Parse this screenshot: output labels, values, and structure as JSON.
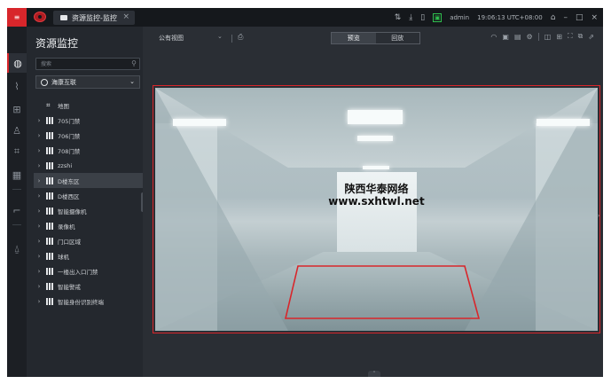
{
  "titlebar": {
    "tab_label": "资源监控-监控",
    "tab_close": "×",
    "user": "admin",
    "clock": "19:06:13 UTC+08:00",
    "window_min": "–",
    "window_max": "□",
    "window_close": "×",
    "menu_glyph": "≡"
  },
  "panel": {
    "title": "资源监控",
    "search_placeholder": "搜索",
    "site_select": "海康互联",
    "tree": [
      {
        "label": "地图",
        "kind": "map",
        "expandable": false,
        "selected": false
      },
      {
        "label": "705门禁",
        "kind": "building",
        "expandable": true,
        "selected": false
      },
      {
        "label": "706门禁",
        "kind": "building",
        "expandable": true,
        "selected": false
      },
      {
        "label": "708门禁",
        "kind": "building",
        "expandable": true,
        "selected": false
      },
      {
        "label": "zzshi",
        "kind": "building",
        "expandable": true,
        "selected": false
      },
      {
        "label": "D楼东区",
        "kind": "building",
        "expandable": true,
        "selected": true
      },
      {
        "label": "D楼西区",
        "kind": "building",
        "expandable": true,
        "selected": false
      },
      {
        "label": "智能摄像机",
        "kind": "building",
        "expandable": true,
        "selected": false
      },
      {
        "label": "录像机",
        "kind": "building",
        "expandable": true,
        "selected": false
      },
      {
        "label": "门口区域",
        "kind": "building",
        "expandable": true,
        "selected": false
      },
      {
        "label": "球机",
        "kind": "building",
        "expandable": true,
        "selected": false
      },
      {
        "label": "一楼出入口门禁",
        "kind": "building",
        "expandable": true,
        "selected": false
      },
      {
        "label": "智能警戒",
        "kind": "building",
        "expandable": true,
        "selected": false
      },
      {
        "label": "智能身份识别终端",
        "kind": "building",
        "expandable": true,
        "selected": false
      }
    ]
  },
  "main": {
    "view_select": "公有视图",
    "tabs": [
      {
        "label": "预览",
        "active": true
      },
      {
        "label": "回放",
        "active": false
      }
    ]
  },
  "video": {
    "watermark_line1": "陕西华泰网络",
    "watermark_line2": "www.sxhtwl.net"
  },
  "colors": {
    "accent": "#d8262b",
    "green": "#2fbf4d",
    "background": "#262a30"
  }
}
